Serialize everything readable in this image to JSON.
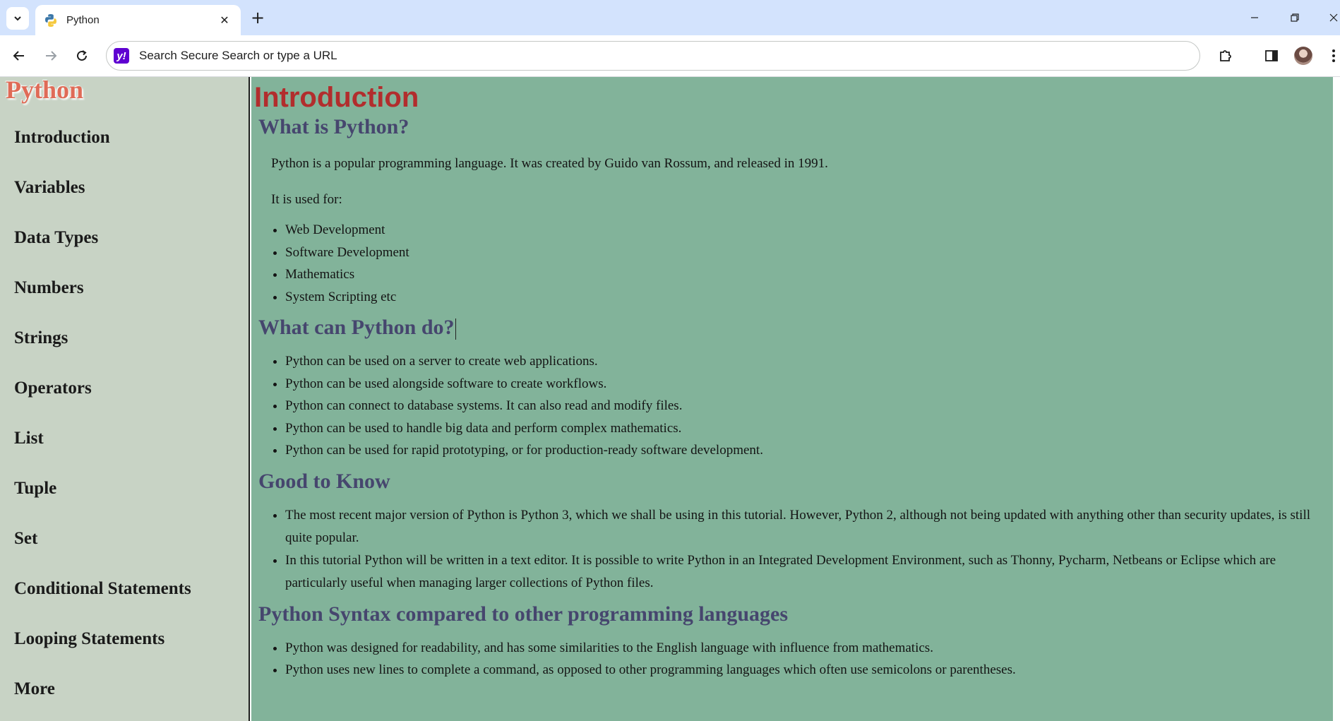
{
  "browser": {
    "tab_title": "Python",
    "omnibox_placeholder": "Search Secure Search or type a URL",
    "icons": {
      "tab_search": "chevron-down-icon",
      "favicon": "python-logo-icon",
      "close_tab": "close-icon",
      "new_tab": "plus-icon",
      "back": "arrow-left-icon",
      "forward": "arrow-right-icon",
      "reload": "reload-icon",
      "search_engine": "yahoo-icon",
      "extensions": "puzzle-icon",
      "side_panel": "side-panel-icon",
      "profile": "avatar",
      "menu": "kebab-menu-icon"
    }
  },
  "sidebar": {
    "logo": "Python",
    "items": [
      {
        "label": "Introduction"
      },
      {
        "label": "Variables"
      },
      {
        "label": "Data Types"
      },
      {
        "label": "Numbers"
      },
      {
        "label": "Strings"
      },
      {
        "label": "Operators"
      },
      {
        "label": "List"
      },
      {
        "label": "Tuple"
      },
      {
        "label": "Set"
      },
      {
        "label": "Conditional Statements"
      },
      {
        "label": "Looping Statements"
      },
      {
        "label": "More"
      }
    ]
  },
  "main": {
    "title": "Introduction",
    "sections": {
      "what": {
        "heading": "What is Python?",
        "para1": "Python is a popular programming language. It was created by Guido van Rossum, and released in 1991.",
        "para2": "It is used for:",
        "items": [
          "Web Development",
          "Software Development",
          "Mathematics",
          "System Scripting etc"
        ]
      },
      "do": {
        "heading": "What can Python do?",
        "items": [
          "Python can be used on a server to create web applications.",
          "Python can be used alongside software to create workflows.",
          "Python can connect to database systems. It can also read and modify files.",
          "Python can be used to handle big data and perform complex mathematics.",
          "Python can be used for rapid prototyping, or for production-ready software development."
        ]
      },
      "good": {
        "heading": "Good to Know",
        "items": [
          "The most recent major version of Python is Python 3, which we shall be using in this tutorial. However, Python 2, although not being updated with anything other than security updates, is still quite popular.",
          "In this tutorial Python will be written in a text editor. It is possible to write Python in an Integrated Development Environment, such as Thonny, Pycharm, Netbeans or Eclipse which are particularly useful when managing larger collections of Python files."
        ]
      },
      "syntax": {
        "heading": "Python Syntax compared to other programming languages",
        "items": [
          "Python was designed for readability, and has some similarities to the English language with influence from mathematics.",
          "Python uses new lines to complete a command, as opposed to other programming languages which often use semicolons or parentheses."
        ]
      }
    }
  },
  "colors": {
    "tabbar": "#d3e3fd",
    "sidebar": "#c8d3c5",
    "content": "#82b39a",
    "title": "#b22d2d",
    "heading": "#46466e",
    "logo": "#df6b57"
  }
}
